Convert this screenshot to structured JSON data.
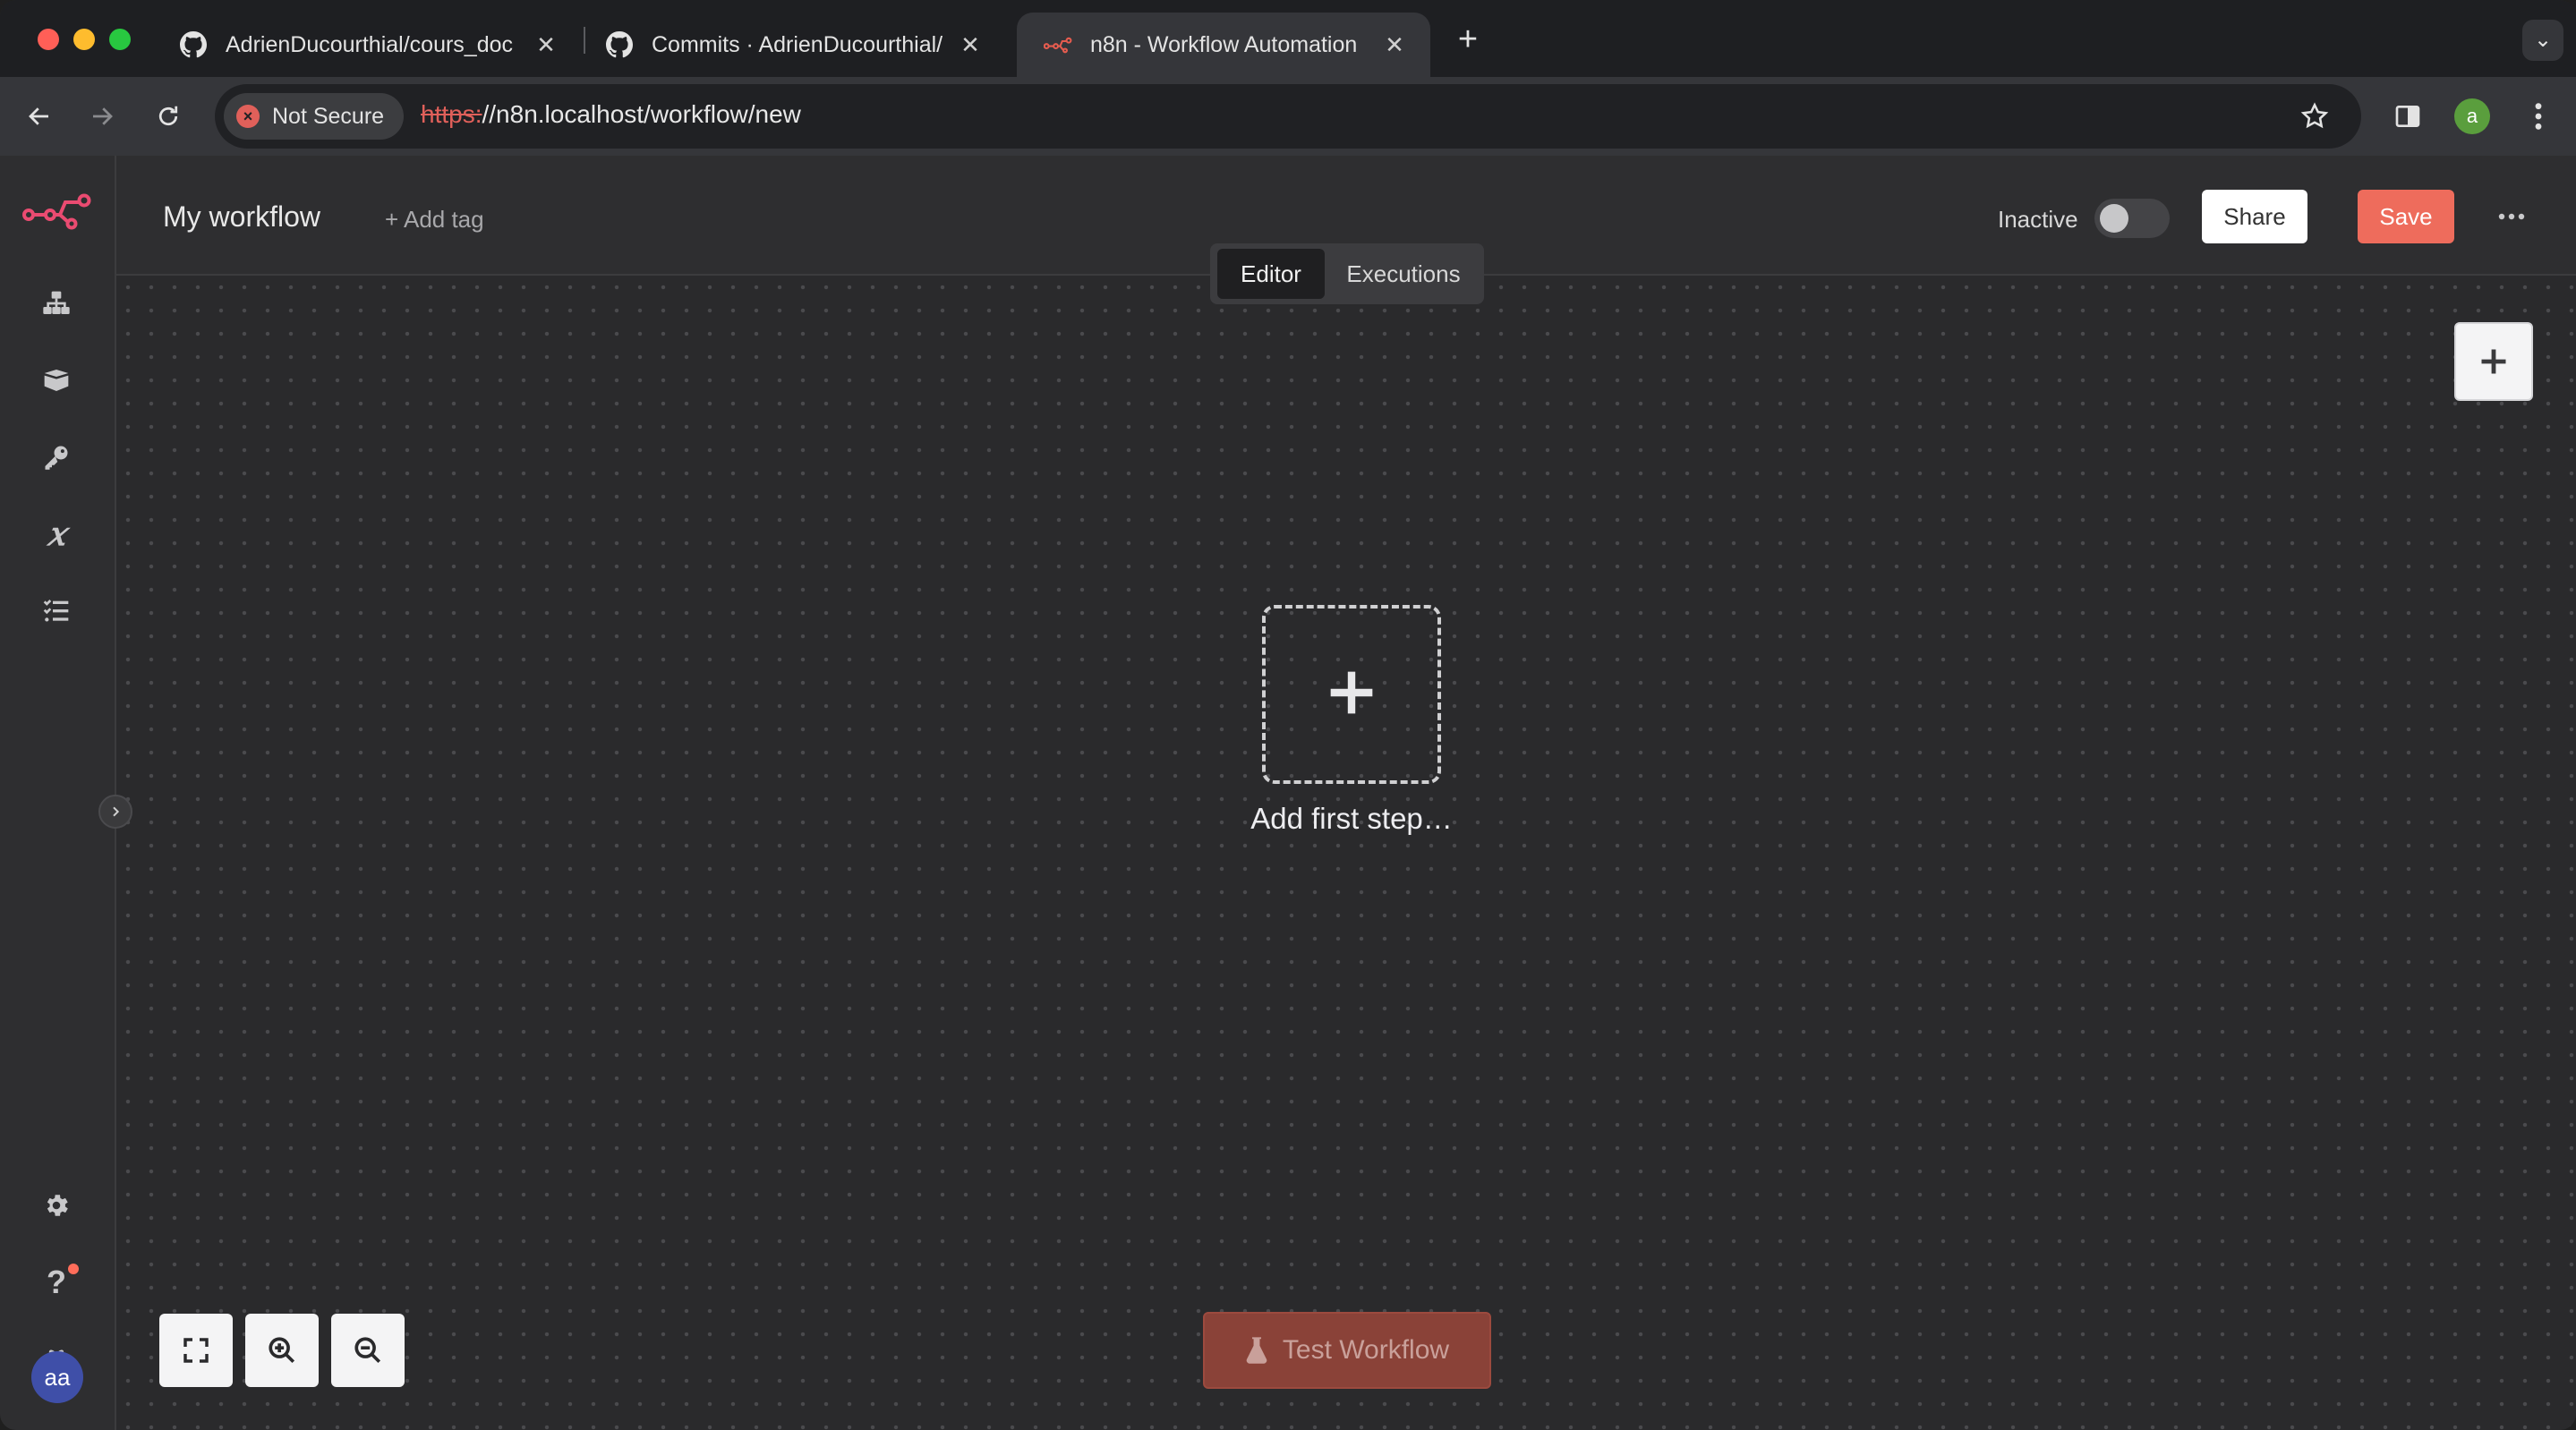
{
  "browser": {
    "tabs": [
      {
        "title": "AdrienDucourthial/cours_doc",
        "icon": "github-icon"
      },
      {
        "title": "Commits · AdrienDucourthial/",
        "icon": "github-icon"
      },
      {
        "title": "n8n - Workflow Automation",
        "icon": "n8n-icon",
        "active": true
      }
    ],
    "security_label": "Not Secure",
    "url_scheme": "https:",
    "url_rest": "//n8n.localhost/workflow/new",
    "profile_initial": "a"
  },
  "app": {
    "workflow_name": "My workflow",
    "add_tag_label": "+ Add tag",
    "status_label": "Inactive",
    "active": false,
    "share_label": "Share",
    "save_label": "Save",
    "mode_tabs": [
      "Editor",
      "Executions"
    ],
    "active_mode": "Editor",
    "first_step_label": "Add first step…",
    "test_workflow_label": "Test Workflow",
    "user_initials": "aa",
    "accent_color": "#ee6c5c",
    "sidebar_icons": [
      "workflows-icon",
      "templates-icon",
      "credentials-icon",
      "variables-icon",
      "executions-icon",
      "settings-icon",
      "help-icon",
      "gift-icon"
    ],
    "zoom_controls": [
      "fit-view-icon",
      "zoom-in-icon",
      "zoom-out-icon"
    ]
  }
}
